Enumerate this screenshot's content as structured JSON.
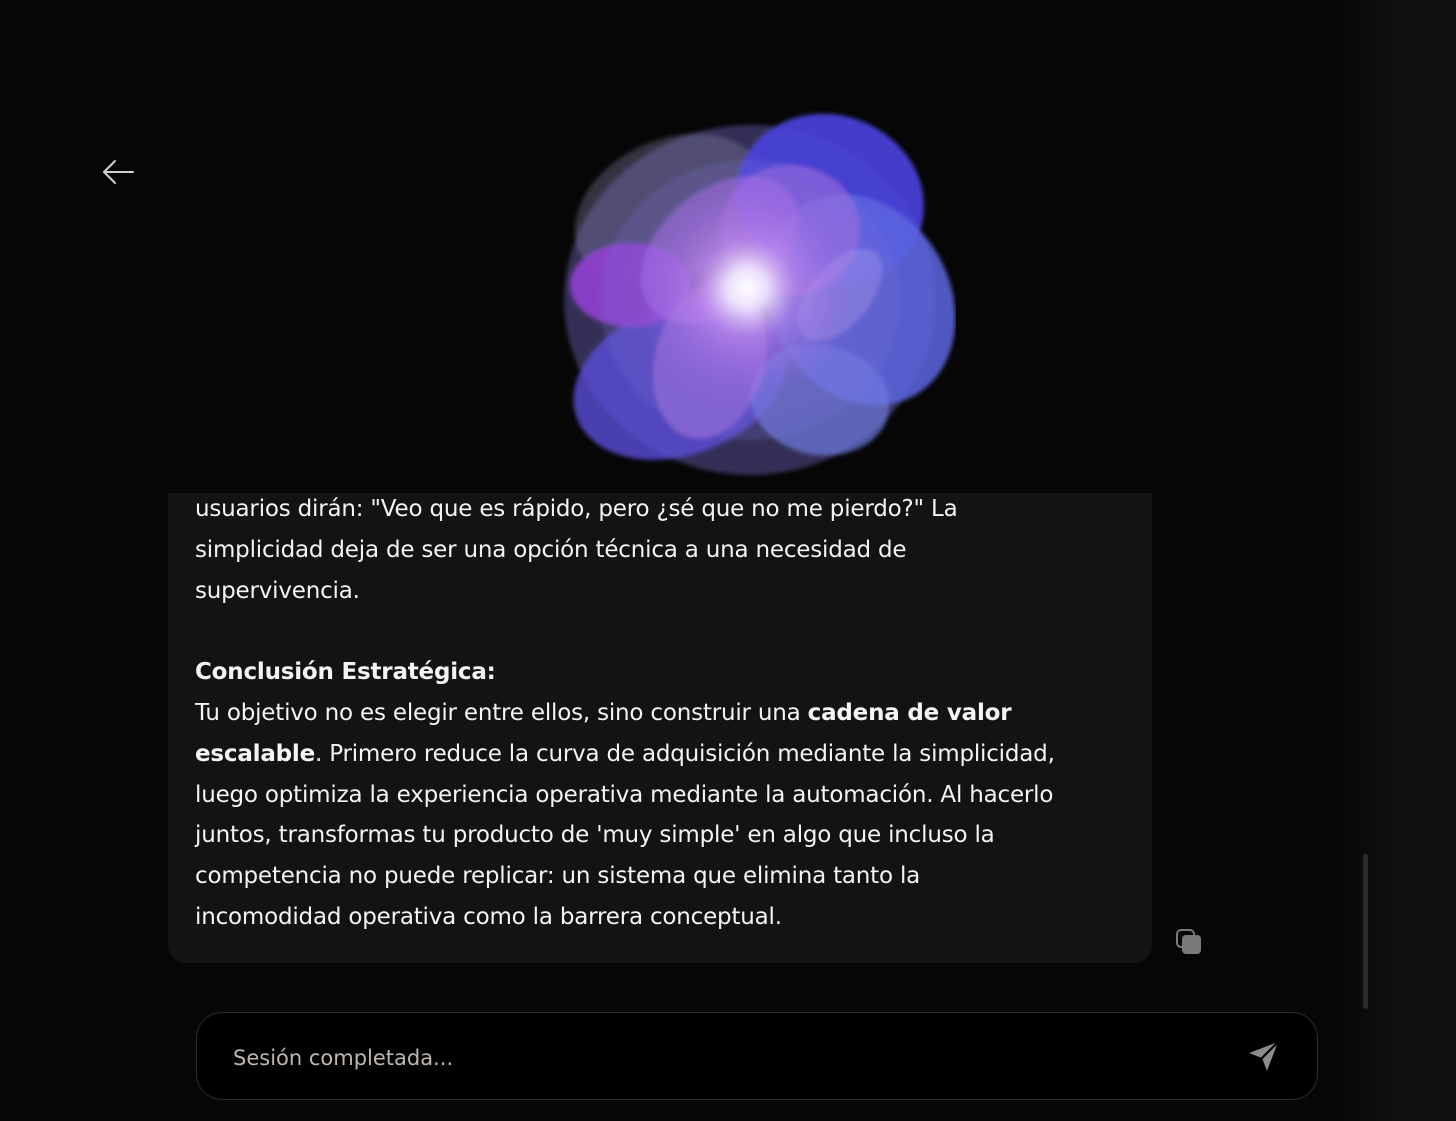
{
  "navigation": {
    "back_icon": "arrow-left-icon"
  },
  "assistant": {
    "avatar": "animated-orb"
  },
  "message": {
    "line1": "usuarios dirán: \"Veo que es rápido, pero ¿sé que no me pierdo?\" La",
    "line2": "simplicidad deja de ser una opción técnica a una necesidad de",
    "line3": "supervivencia.",
    "conclusion_heading": "Conclusión Estratégica:",
    "p2_line1_start": "Tu objetivo no es elegir entre ellos, sino construir una ",
    "p2_bold_1": "cadena de valor",
    "p2_bold_2": "escalable",
    "p2_line2_end": ". Primero reduce la curva de adquisición mediante la simplicidad,",
    "p2_line3": "luego optimiza la experiencia operativa mediante la automación. Al hacerlo",
    "p2_line4": "juntos, transformas tu producto de 'muy simple' en algo que incluso la",
    "p2_line5": "competencia no puede replicar: un sistema que elimina tanto la",
    "p2_line6": "incomodidad operativa como la barrera conceptual."
  },
  "actions": {
    "copy_icon": "copy-icon"
  },
  "composer": {
    "placeholder": "Sesión completada...",
    "value": "",
    "send_icon": "send-icon"
  },
  "colors": {
    "background": "#060606",
    "card": "#131313",
    "text": "#f4f4f4",
    "orb_primary": "#6a4de8",
    "orb_secondary": "#a05ad8"
  }
}
